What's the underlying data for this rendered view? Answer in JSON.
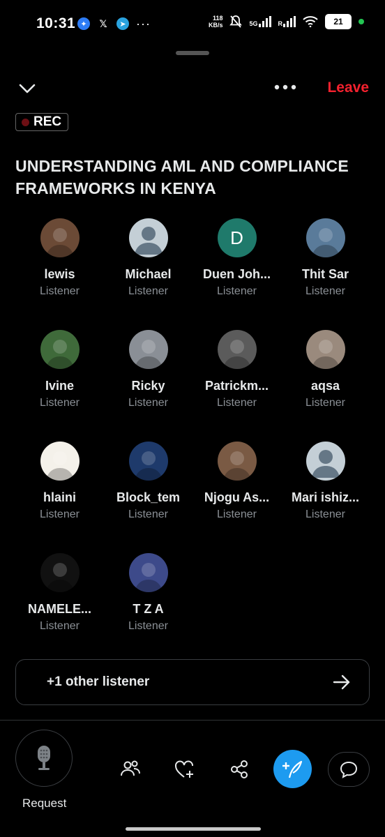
{
  "status_bar": {
    "time": "10:31",
    "net_speed_value": "118",
    "net_speed_unit": "KB/s",
    "network": "5G",
    "roaming": "R",
    "battery": "21"
  },
  "header": {
    "leave_label": "Leave"
  },
  "rec_badge": "REC",
  "space_title": "UNDERSTANDING AML AND COMPLIANCE FRAMEWORKS IN KENYA",
  "listeners": [
    {
      "name": "lewis",
      "role": "Listener",
      "avatar": "photo",
      "color": "#6b4a36"
    },
    {
      "name": "Michael",
      "role": "Listener",
      "avatar": "default",
      "color": "#c4cfd6"
    },
    {
      "name": "Duen Joh...",
      "role": "Listener",
      "avatar": "letter",
      "letter": "D",
      "color": "#1f7a6b"
    },
    {
      "name": "Thit Sar",
      "role": "Listener",
      "avatar": "photo",
      "color": "#5a7b9a"
    },
    {
      "name": "Ivine",
      "role": "Listener",
      "avatar": "photo",
      "color": "#3f6a3a"
    },
    {
      "name": "Ricky",
      "role": "Listener",
      "avatar": "photo",
      "color": "#8a8f96"
    },
    {
      "name": "Patrickm...",
      "role": "Listener",
      "avatar": "photo",
      "color": "#5b5b5b"
    },
    {
      "name": "aqsa",
      "role": "Listener",
      "avatar": "photo",
      "color": "#9a8a7d"
    },
    {
      "name": "hlaini",
      "role": "Listener",
      "avatar": "photo",
      "color": "#f4f1ea"
    },
    {
      "name": "Block_tem",
      "role": "Listener",
      "avatar": "photo",
      "color": "#1e3a6b"
    },
    {
      "name": "Njogu As...",
      "role": "Listener",
      "avatar": "photo",
      "color": "#7a5a44"
    },
    {
      "name": "Mari ishiz...",
      "role": "Listener",
      "avatar": "default",
      "color": "#c4cfd6"
    },
    {
      "name": "NAMELE...",
      "role": "Listener",
      "avatar": "photo",
      "color": "#111111"
    },
    {
      "name": "T Z A",
      "role": "Listener",
      "avatar": "photo",
      "color": "#3d4a8a"
    }
  ],
  "other_listeners_label": "+1 other listener",
  "toolbar": {
    "request_label": "Request"
  }
}
